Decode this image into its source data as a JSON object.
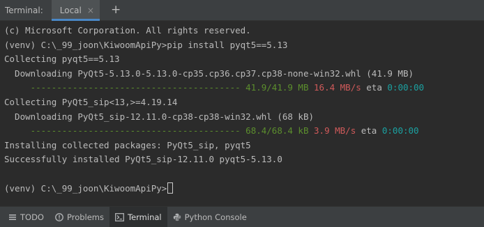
{
  "header": {
    "title": "Terminal:",
    "tab_label": "Local",
    "close_glyph": "×",
    "new_tab_glyph": "+"
  },
  "terminal": {
    "lines": [
      {
        "segments": [
          {
            "text": "(c) Microsoft Corporation. All rights reserved.",
            "color": "default"
          }
        ]
      },
      {
        "segments": [
          {
            "text": "(venv) C:\\_99_joon\\KiwoomApiPy>pip install pyqt5==5.13",
            "color": "default"
          }
        ]
      },
      {
        "segments": [
          {
            "text": "Collecting pyqt5==5.13",
            "color": "default"
          }
        ]
      },
      {
        "segments": [
          {
            "text": "  Downloading PyQt5-5.13.0-5.13.0-cp35.cp36.cp37.cp38-none-win32.whl (41.9 MB)",
            "color": "default"
          }
        ]
      },
      {
        "segments": [
          {
            "text": "     ---------------------------------------- 41.9/41.9 MB ",
            "color": "green"
          },
          {
            "text": "16.4 MB/s",
            "color": "red"
          },
          {
            "text": " eta ",
            "color": "default"
          },
          {
            "text": "0:00:00",
            "color": "cyan"
          }
        ]
      },
      {
        "segments": [
          {
            "text": "Collecting PyQt5_sip<13,>=4.19.14",
            "color": "default"
          }
        ]
      },
      {
        "segments": [
          {
            "text": "  Downloading PyQt5_sip-12.11.0-cp38-cp38-win32.whl (68 kB)",
            "color": "default"
          }
        ]
      },
      {
        "segments": [
          {
            "text": "     ---------------------------------------- 68.4/68.4 kB ",
            "color": "green"
          },
          {
            "text": "3.9 MB/s",
            "color": "red"
          },
          {
            "text": " eta ",
            "color": "default"
          },
          {
            "text": "0:00:00",
            "color": "cyan"
          }
        ]
      },
      {
        "segments": [
          {
            "text": "Installing collected packages: PyQt5_sip, pyqt5",
            "color": "default"
          }
        ]
      },
      {
        "segments": [
          {
            "text": "Successfully installed PyQt5_sip-12.11.0 pyqt5-5.13.0",
            "color": "default"
          }
        ]
      },
      {
        "segments": [
          {
            "text": "",
            "color": "default"
          }
        ]
      },
      {
        "segments": [
          {
            "text": "(venv) C:\\_99_joon\\KiwoomApiPy>",
            "color": "default"
          }
        ],
        "cursor": true
      }
    ]
  },
  "bottom_tabs": [
    {
      "label": "TODO",
      "icon": "list-icon",
      "active": false
    },
    {
      "label": "Problems",
      "icon": "problems-icon",
      "active": false
    },
    {
      "label": "Terminal",
      "icon": "terminal-icon",
      "active": true
    },
    {
      "label": "Python Console",
      "icon": "python-icon",
      "active": false
    }
  ],
  "colors": {
    "background": "#2b2b2b",
    "text": "#bbbbbb",
    "progress_green": "#5c8f2d",
    "speed_red": "#d05a5a",
    "eta_cyan": "#1ba1a1",
    "tab_accent": "#4a88c7"
  }
}
